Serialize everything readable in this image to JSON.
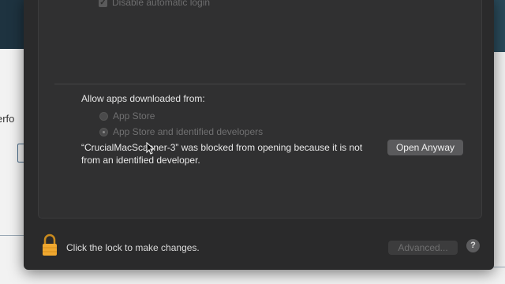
{
  "background": {
    "left_text_fragment": "erfo"
  },
  "login_options": {
    "disable_automatic_login_label": "Disable automatic login",
    "disable_automatic_login_checked": true
  },
  "allow_apps": {
    "heading": "Allow apps downloaded from:",
    "options": [
      {
        "label": "App Store",
        "selected": false
      },
      {
        "label": "App Store and identified developers",
        "selected": true
      }
    ]
  },
  "blocked_message": {
    "line1": "“CrucialMacScanner-3” was blocked from opening because it is not",
    "line2": "from an identified developer.",
    "open_anyway_label": "Open Anyway"
  },
  "footer": {
    "lock_label": "Click the lock to make changes.",
    "advanced_label": "Advanced...",
    "help_label": "?"
  },
  "icons": {
    "lock": "lock-icon",
    "cursor": "pointer-cursor-icon",
    "checkmark": "checkmark-icon"
  },
  "colors": {
    "sheet_bg": "#2a2a2b",
    "panel_bg": "#303031",
    "lock_color": "#f0a830"
  }
}
